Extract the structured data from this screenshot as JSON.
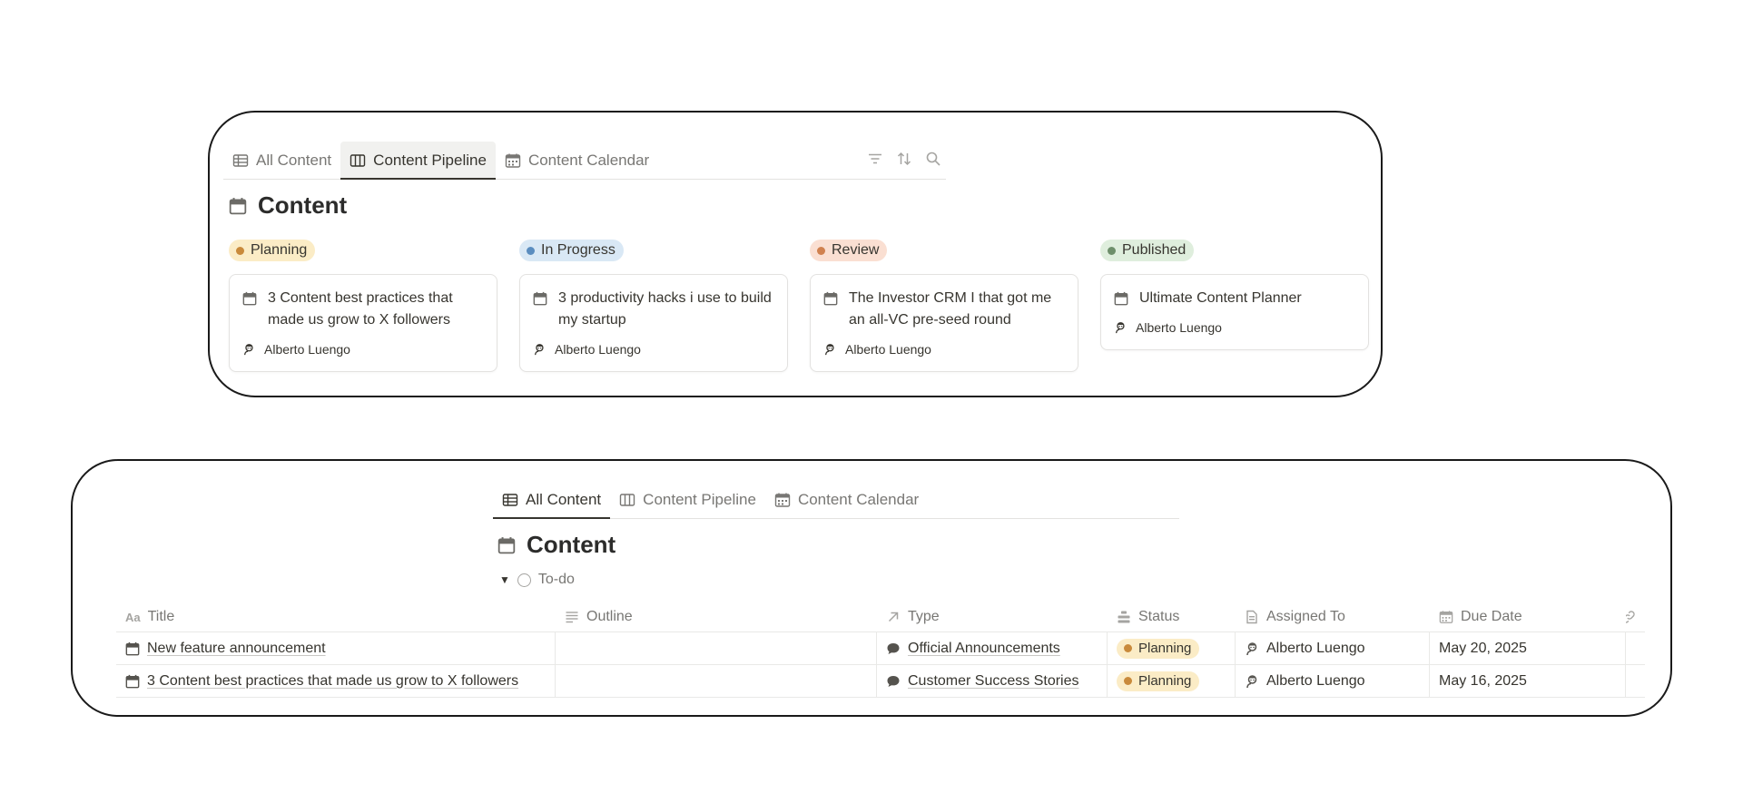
{
  "colors": {
    "planning_bg": "#fbecc6",
    "planning_dot": "#c98a3b",
    "progress_bg": "#d9e8f5",
    "progress_dot": "#5b8dbf",
    "review_bg": "#fadfd2",
    "review_dot": "#d0814f",
    "published_bg": "#dfeedd",
    "published_dot": "#6e8f6b"
  },
  "board_view": {
    "tabs": [
      {
        "label": "All Content",
        "icon": "table-icon"
      },
      {
        "label": "Content Pipeline",
        "icon": "board-icon"
      },
      {
        "label": "Content Calendar",
        "icon": "calendar-icon"
      }
    ],
    "active_tab": "Content Pipeline",
    "tools": [
      "filter-icon",
      "sort-icon",
      "search-icon"
    ],
    "title": "Content",
    "columns": [
      {
        "status": "Planning",
        "cards": [
          {
            "title": "3 Content best practices that made us grow to X followers",
            "person": "Alberto Luengo"
          }
        ]
      },
      {
        "status": "In Progress",
        "cards": [
          {
            "title": "3 productivity hacks i use to build my startup",
            "person": "Alberto Luengo"
          }
        ]
      },
      {
        "status": "Review",
        "cards": [
          {
            "title": "The Investor CRM I that got me an all-VC pre-seed round",
            "person": "Alberto Luengo"
          }
        ]
      },
      {
        "status": "Published",
        "cards": [
          {
            "title": "Ultimate Content Planner",
            "person": "Alberto Luengo"
          }
        ]
      }
    ]
  },
  "table_view": {
    "tabs": [
      {
        "label": "All Content",
        "icon": "table-icon"
      },
      {
        "label": "Content Pipeline",
        "icon": "board-icon"
      },
      {
        "label": "Content Calendar",
        "icon": "calendar-icon"
      }
    ],
    "active_tab": "All Content",
    "title": "Content",
    "group_label": "To-do",
    "columns": [
      {
        "label": "Title",
        "icon": "text-type-icon"
      },
      {
        "label": "Outline",
        "icon": "lines-icon"
      },
      {
        "label": "Type",
        "icon": "arrow-up-right-icon"
      },
      {
        "label": "Status",
        "icon": "status-icon"
      },
      {
        "label": "Assigned To",
        "icon": "document-icon"
      },
      {
        "label": "Due Date",
        "icon": "calendar-icon"
      }
    ],
    "rows": [
      {
        "title": "New feature announcement",
        "outline": "",
        "type": "Official Announcements",
        "status": "Planning",
        "assigned": "Alberto Luengo",
        "due": "May 20, 2025"
      },
      {
        "title": "3 Content best practices that made us grow to X followers",
        "outline": "",
        "type": "Customer Success Stories",
        "status": "Planning",
        "assigned": "Alberto Luengo",
        "due": "May 16, 2025"
      }
    ]
  }
}
